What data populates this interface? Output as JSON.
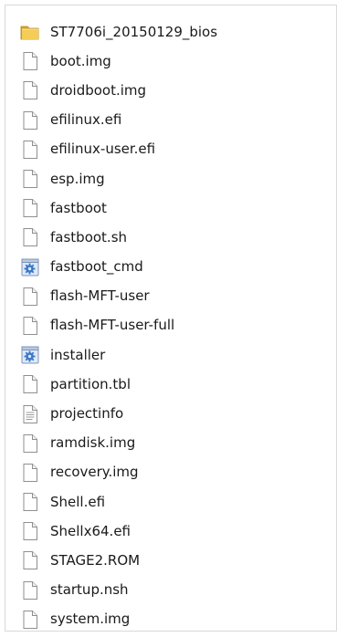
{
  "files": [
    {
      "name": "ST7706i_20150129_bios",
      "icon": "folder-icon"
    },
    {
      "name": "boot.img",
      "icon": "file-icon"
    },
    {
      "name": "droidboot.img",
      "icon": "file-icon"
    },
    {
      "name": "efilinux.efi",
      "icon": "file-icon"
    },
    {
      "name": "efilinux-user.efi",
      "icon": "file-icon"
    },
    {
      "name": "esp.img",
      "icon": "file-icon"
    },
    {
      "name": "fastboot",
      "icon": "file-icon"
    },
    {
      "name": "fastboot.sh",
      "icon": "file-icon"
    },
    {
      "name": "fastboot_cmd",
      "icon": "system-file-icon"
    },
    {
      "name": "flash-MFT-user",
      "icon": "file-icon"
    },
    {
      "name": "flash-MFT-user-full",
      "icon": "file-icon"
    },
    {
      "name": "installer",
      "icon": "system-file-icon"
    },
    {
      "name": "partition.tbl",
      "icon": "file-icon"
    },
    {
      "name": "projectinfo",
      "icon": "text-file-icon"
    },
    {
      "name": "ramdisk.img",
      "icon": "file-icon"
    },
    {
      "name": "recovery.img",
      "icon": "file-icon"
    },
    {
      "name": "Shell.efi",
      "icon": "file-icon"
    },
    {
      "name": "Shellx64.efi",
      "icon": "file-icon"
    },
    {
      "name": "STAGE2.ROM",
      "icon": "file-icon"
    },
    {
      "name": "startup.nsh",
      "icon": "file-icon"
    },
    {
      "name": "system.img",
      "icon": "file-icon"
    }
  ],
  "colors": {
    "folder": "#e8b83a",
    "page_border": "#8f8f8f",
    "system_gear": "#3a79c7",
    "text": "#1a1a1a"
  }
}
